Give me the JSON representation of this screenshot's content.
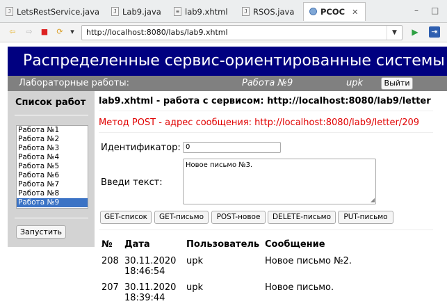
{
  "tabs": [
    {
      "label": "LetsRestService.java",
      "icon": "java-file-icon"
    },
    {
      "label": "Lab9.java",
      "icon": "java-file-icon"
    },
    {
      "label": "lab9.xhtml",
      "icon": "xhtml-file-icon"
    },
    {
      "label": "RSOS.java",
      "icon": "java-file-icon"
    },
    {
      "label": "РСОС",
      "icon": "browser-globe-icon",
      "active": true
    }
  ],
  "tab_close": "✕",
  "window_controls": {
    "minimize": "–",
    "maximize": "□"
  },
  "toolbar": {
    "url": "http://localhost:8080/labs/lab9.xhtml",
    "back": "⇦",
    "forward": "⇨",
    "stop": "■",
    "refresh": "⟳",
    "menu": "▾",
    "url_drop": "▼",
    "go": "▶",
    "open_ext": "⇥"
  },
  "page": {
    "banner": "Распределенные сервис-ориентированные системы",
    "userbar": {
      "left": "Лабораторные работы:",
      "work": "Работа №9",
      "user": "upk",
      "logout": "Выйти"
    },
    "sidebar": {
      "title": "Список работ",
      "labs": [
        "Работа №1",
        "Работа №2",
        "Работа №3",
        "Работа №4",
        "Работа №5",
        "Работа №6",
        "Работа №7",
        "Работа №8",
        "Работа №9"
      ],
      "selected_index": 8,
      "run_button": "Запустить"
    },
    "main": {
      "title": "lab9.xhtml - работа с сервисом: http://localhost:8080/lab9/letter",
      "method_info": "Метод POST - адрес сообщения: http://localhost:8080/lab9/letter/209",
      "id_label": "Идентификатор:",
      "id_value": "0",
      "text_label": "Введи текст:",
      "text_value": "Новое письмо №3.",
      "buttons": [
        "GET-список",
        "GET-письмо",
        "POST-новое",
        "DELETE-письмо",
        "PUT-письмо"
      ]
    },
    "table": {
      "headers": [
        "№",
        "Дата",
        "Пользователь",
        "Сообщение"
      ],
      "rows": [
        {
          "num": "208",
          "date": "30.11.2020",
          "time": "18:46:54",
          "user": "upk",
          "message": "Новое письмо №2."
        },
        {
          "num": "207",
          "date": "30.11.2020",
          "time": "18:39:44",
          "user": "upk",
          "message": "Новое письмо."
        }
      ]
    }
  }
}
